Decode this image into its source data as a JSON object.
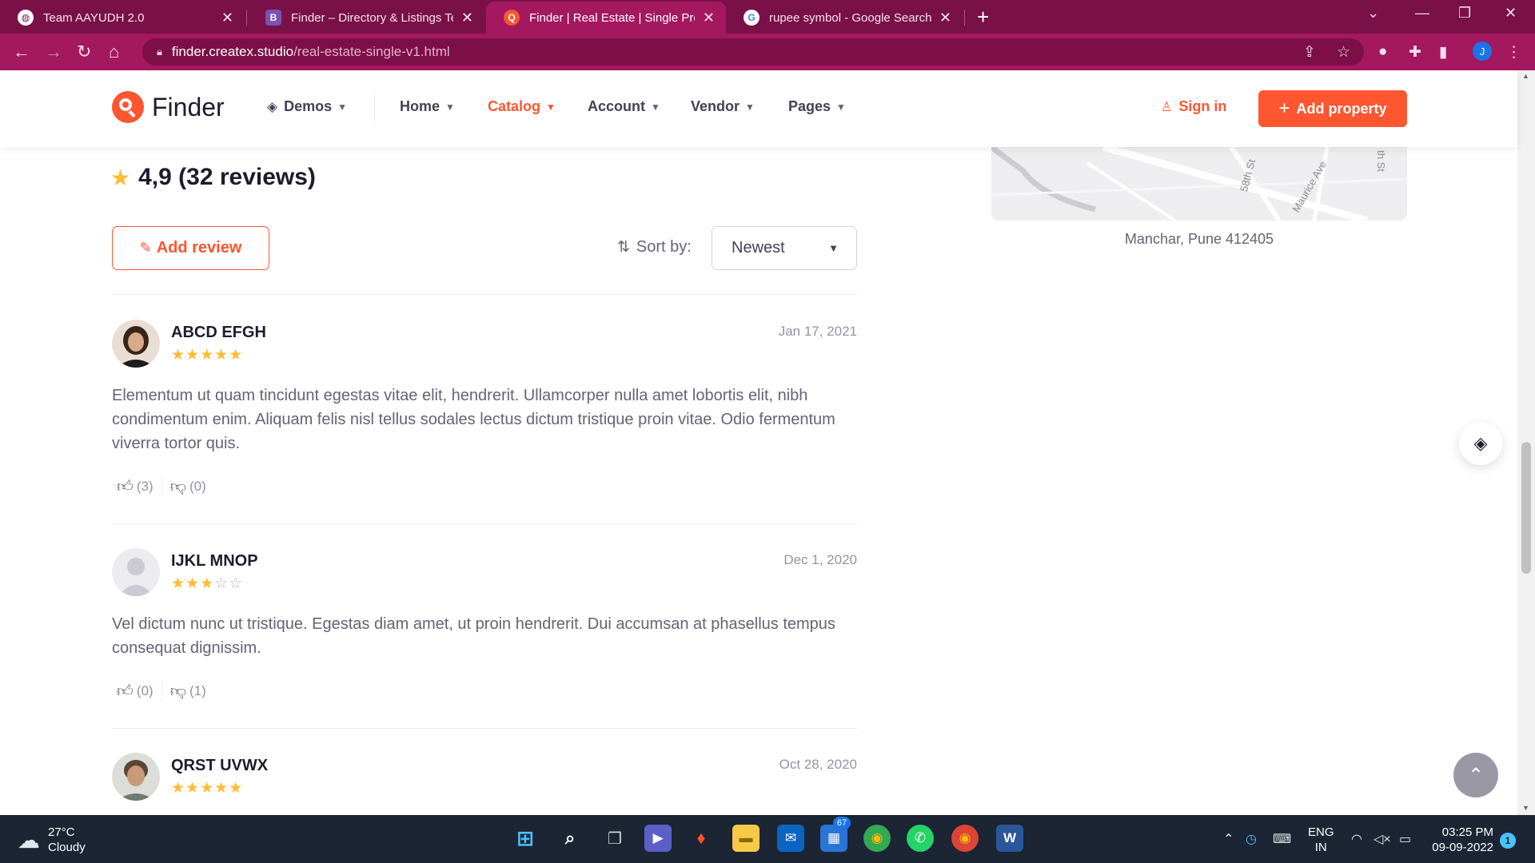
{
  "browser": {
    "tabs": [
      {
        "title": "Team AAYUDH 2.0",
        "icon": "globe-icon",
        "active": false
      },
      {
        "title": "Finder – Directory & Listings Tem",
        "icon": "bootstrap-icon",
        "active": false
      },
      {
        "title": "Finder | Real Estate | Single Prope",
        "icon": "finder-logo-icon",
        "active": true
      },
      {
        "title": "rupee symbol - Google Search",
        "icon": "google-icon",
        "active": false
      }
    ],
    "url_domain": "finder.createx.studio",
    "url_path": "/real-estate-single-v1.html",
    "profile_initial": "J"
  },
  "header": {
    "logo_text": "Finder",
    "nav": [
      {
        "label": "Demos",
        "active": false
      },
      {
        "label": "Home",
        "active": false
      },
      {
        "label": "Catalog",
        "active": true
      },
      {
        "label": "Account",
        "active": false
      },
      {
        "label": "Vendor",
        "active": false
      },
      {
        "label": "Pages",
        "active": false
      }
    ],
    "sign_in": "Sign in",
    "add_property": "Add property",
    "accent_color": "#fd5631"
  },
  "reviews_section": {
    "rating_summary": "4,9 (32 reviews)",
    "add_review_label": "Add review",
    "sort_label": "Sort by:",
    "sort_value": "Newest",
    "reviews": [
      {
        "name": "ABCD EFGH",
        "date": "Jan 17, 2021",
        "rating": 5,
        "text": "Elementum ut quam tincidunt egestas vitae elit, hendrerit. Ullamcorper nulla amet lobortis elit, nibh condimentum enim. Aliquam felis nisl tellus sodales lectus dictum tristique proin vitae. Odio fermentum viverra tortor quis.",
        "likes": "(3)",
        "dislikes": "(0)"
      },
      {
        "name": "IJKL MNOP",
        "date": "Dec 1, 2020",
        "rating": 3,
        "text": "Vel dictum nunc ut tristique. Egestas diam amet, ut proin hendrerit. Dui accumsan at phasellus tempus consequat dignissim.",
        "likes": "(0)",
        "dislikes": "(1)"
      },
      {
        "name": "QRST UVWX",
        "date": "Oct 28, 2020",
        "rating": 5
      }
    ]
  },
  "sidebar": {
    "map_labels": [
      "58th St",
      "Maurice Ave",
      "th St"
    ],
    "address": "Manchar, Pune 412405"
  },
  "taskbar": {
    "weather_temp": "27°C",
    "weather_desc": "Cloudy",
    "store_badge": "67",
    "lang_top": "ENG",
    "lang_bottom": "IN",
    "time": "03:25 PM",
    "date": "09-09-2022",
    "notifications": "1"
  }
}
